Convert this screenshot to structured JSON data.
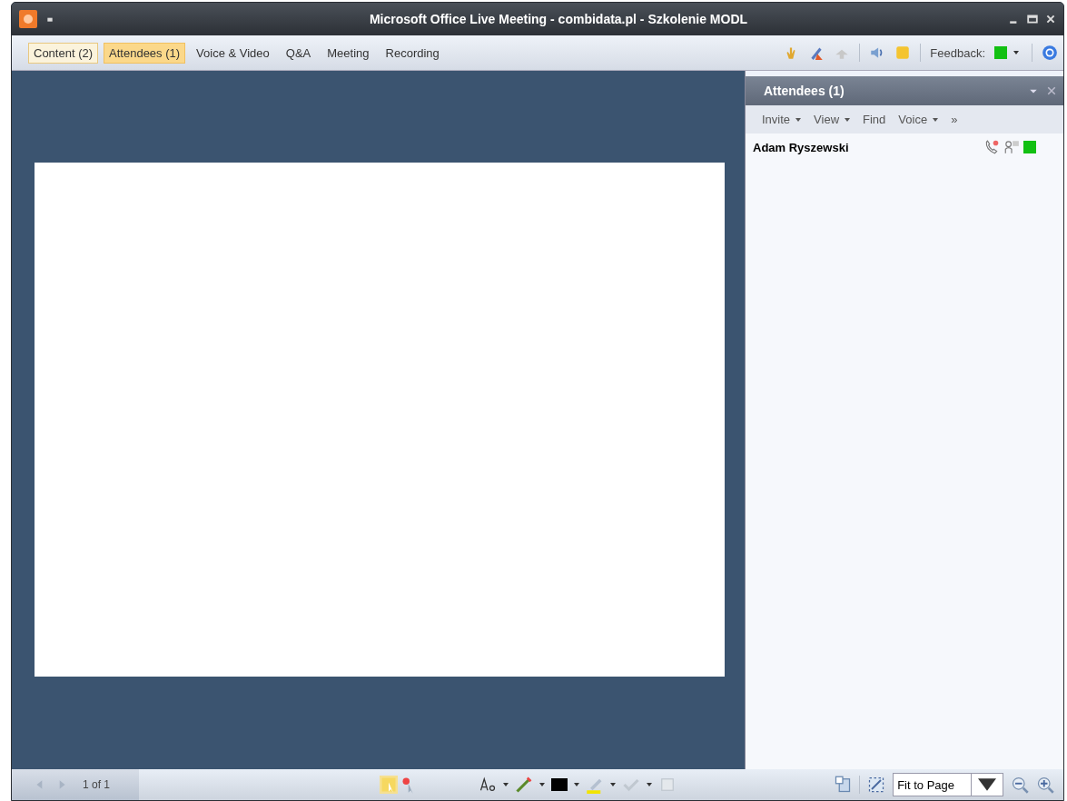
{
  "window": {
    "title": "Microsoft Office Live Meeting - combidata.pl - Szkolenie MODL"
  },
  "tabs": [
    {
      "label": "Content (2)",
      "selected": false,
      "open": true
    },
    {
      "label": "Attendees (1)",
      "selected": true,
      "open": false
    },
    {
      "label": "Voice & Video",
      "selected": false,
      "open": false
    },
    {
      "label": "Q&A",
      "selected": false,
      "open": false
    },
    {
      "label": "Meeting",
      "selected": false,
      "open": false
    },
    {
      "label": "Recording",
      "selected": false,
      "open": false
    }
  ],
  "feedback": {
    "label": "Feedback:",
    "color": "#12c012"
  },
  "attendees_panel": {
    "title": "Attendees (1)",
    "menu": [
      {
        "label": "Invite",
        "dropdown": true
      },
      {
        "label": "View",
        "dropdown": true
      },
      {
        "label": "Find",
        "dropdown": false
      },
      {
        "label": "Voice",
        "dropdown": true
      },
      {
        "label": "»",
        "dropdown": false
      }
    ],
    "attendees": [
      {
        "name": "Adam Ryszewski",
        "color": "#12c012"
      }
    ]
  },
  "status_bar": {
    "page": "1 of 1",
    "zoom": "Fit to Page"
  }
}
